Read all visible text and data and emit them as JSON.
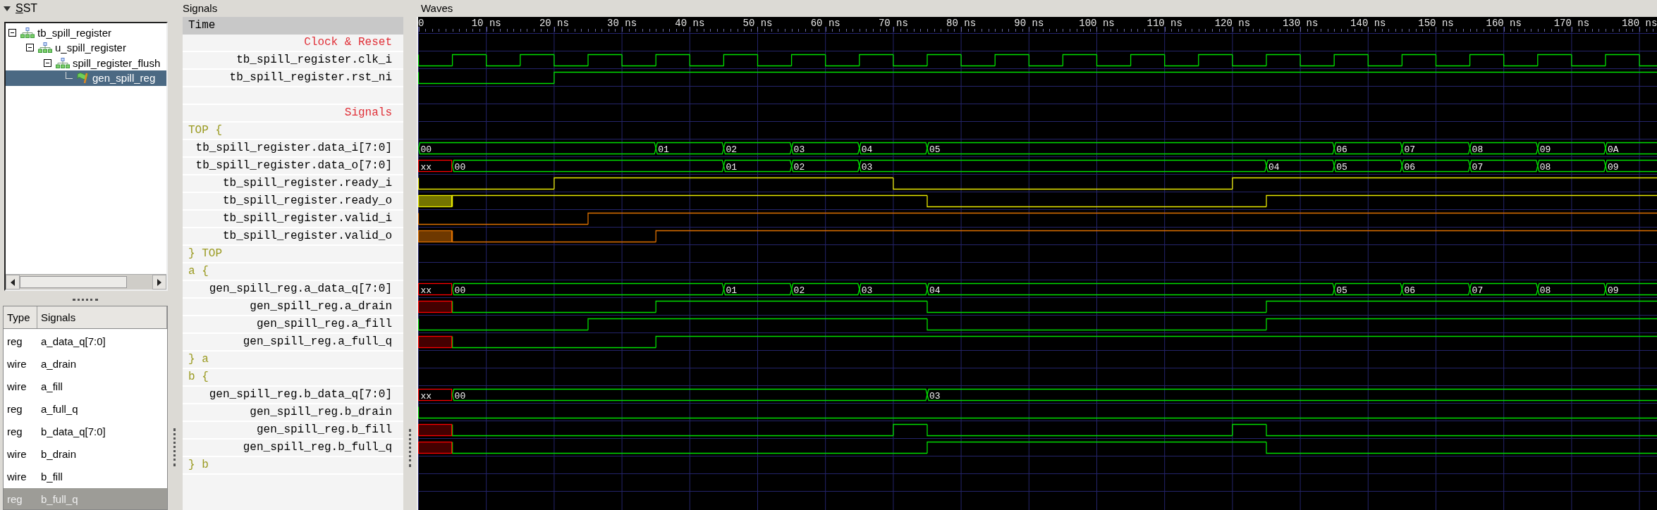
{
  "sst": {
    "title": "SST",
    "expanded": true,
    "tree": [
      {
        "label": "tb_spill_register",
        "kind": "module",
        "expanded": true,
        "selected": false,
        "children": [
          {
            "label": "u_spill_register",
            "kind": "module",
            "expanded": true,
            "selected": false,
            "children": [
              {
                "label": "spill_register_flush",
                "kind": "module",
                "expanded": true,
                "selected": false,
                "children": [
                  {
                    "label": "gen_spill_reg",
                    "kind": "generate",
                    "selected": true
                  }
                ]
              }
            ]
          }
        ]
      }
    ]
  },
  "signal_table": {
    "columns": [
      "Type",
      "Signals"
    ],
    "rows": [
      {
        "type": "reg",
        "name": "a_data_q[7:0]",
        "selected": false
      },
      {
        "type": "wire",
        "name": "a_drain",
        "selected": false
      },
      {
        "type": "wire",
        "name": "a_fill",
        "selected": false
      },
      {
        "type": "reg",
        "name": "a_full_q",
        "selected": false
      },
      {
        "type": "reg",
        "name": "b_data_q[7:0]",
        "selected": false
      },
      {
        "type": "wire",
        "name": "b_drain",
        "selected": false
      },
      {
        "type": "wire",
        "name": "b_fill",
        "selected": false
      },
      {
        "type": "reg",
        "name": "b_full_q",
        "selected": true
      }
    ]
  },
  "signals": {
    "title": "Signals",
    "header": "Time",
    "items": [
      {
        "kind": "comment",
        "text": "Clock & Reset"
      },
      {
        "kind": "bit_signal",
        "name": "tb_spill_register.clk_i"
      },
      {
        "kind": "bit_signal",
        "name": "tb_spill_register.rst_ni"
      },
      {
        "kind": "blank"
      },
      {
        "kind": "comment",
        "text": "Signals"
      },
      {
        "kind": "group_open",
        "text": "TOP {"
      },
      {
        "kind": "bus_signal",
        "name": "tb_spill_register.data_i[7:0]",
        "labels": [
          "00",
          "01",
          "02",
          "03",
          "04",
          "05",
          "06",
          "07",
          "08",
          "09",
          "0A"
        ]
      },
      {
        "kind": "bus_signal",
        "name": "tb_spill_register.data_o[7:0]",
        "labels": [
          "xx",
          "00",
          "01",
          "02",
          "03",
          "04",
          "05",
          "06",
          "07",
          "08",
          "09"
        ]
      },
      {
        "kind": "bit_signal",
        "name": "tb_spill_register.ready_i",
        "color": "#e8e800"
      },
      {
        "kind": "bit_signal",
        "name": "tb_spill_register.ready_o",
        "color": "#e8e800"
      },
      {
        "kind": "bit_signal",
        "name": "tb_spill_register.valid_i",
        "color": "#dd7000"
      },
      {
        "kind": "bit_signal",
        "name": "tb_spill_register.valid_o",
        "color": "#dd7000"
      },
      {
        "kind": "group_close",
        "text": "} TOP"
      },
      {
        "kind": "group_open",
        "text": "a {"
      },
      {
        "kind": "bus_signal",
        "name": "gen_spill_reg.a_data_q[7:0]",
        "labels": [
          "xx",
          "00",
          "01",
          "02",
          "03",
          "04",
          "05",
          "06",
          "07",
          "08",
          "09"
        ]
      },
      {
        "kind": "bit_signal",
        "name": "gen_spill_reg.a_drain"
      },
      {
        "kind": "bit_signal",
        "name": "gen_spill_reg.a_fill"
      },
      {
        "kind": "bit_signal",
        "name": "gen_spill_reg.a_full_q"
      },
      {
        "kind": "group_close",
        "text": "} a"
      },
      {
        "kind": "group_open",
        "text": "b {"
      },
      {
        "kind": "bus_signal",
        "name": "gen_spill_reg.b_data_q[7:0]",
        "labels": [
          "xx",
          "00",
          "03"
        ]
      },
      {
        "kind": "bit_signal",
        "name": "gen_spill_reg.b_drain"
      },
      {
        "kind": "bit_signal",
        "name": "gen_spill_reg.b_fill"
      },
      {
        "kind": "bit_signal",
        "name": "gen_spill_reg.b_full_q"
      },
      {
        "kind": "group_close",
        "text": "} b"
      }
    ]
  },
  "waves": {
    "title": "Waves",
    "time_labels": [
      "0",
      "10 ns",
      "20 ns",
      "30 ns",
      "40 ns",
      "50 ns",
      "60 ns",
      "70 ns",
      "80 ns",
      "90 ns",
      "100 ns",
      "110 ns",
      "120 ns",
      "130 ns",
      "140 ns",
      "150 ns",
      "160 ns",
      "170 ns",
      "180 ns"
    ]
  }
}
